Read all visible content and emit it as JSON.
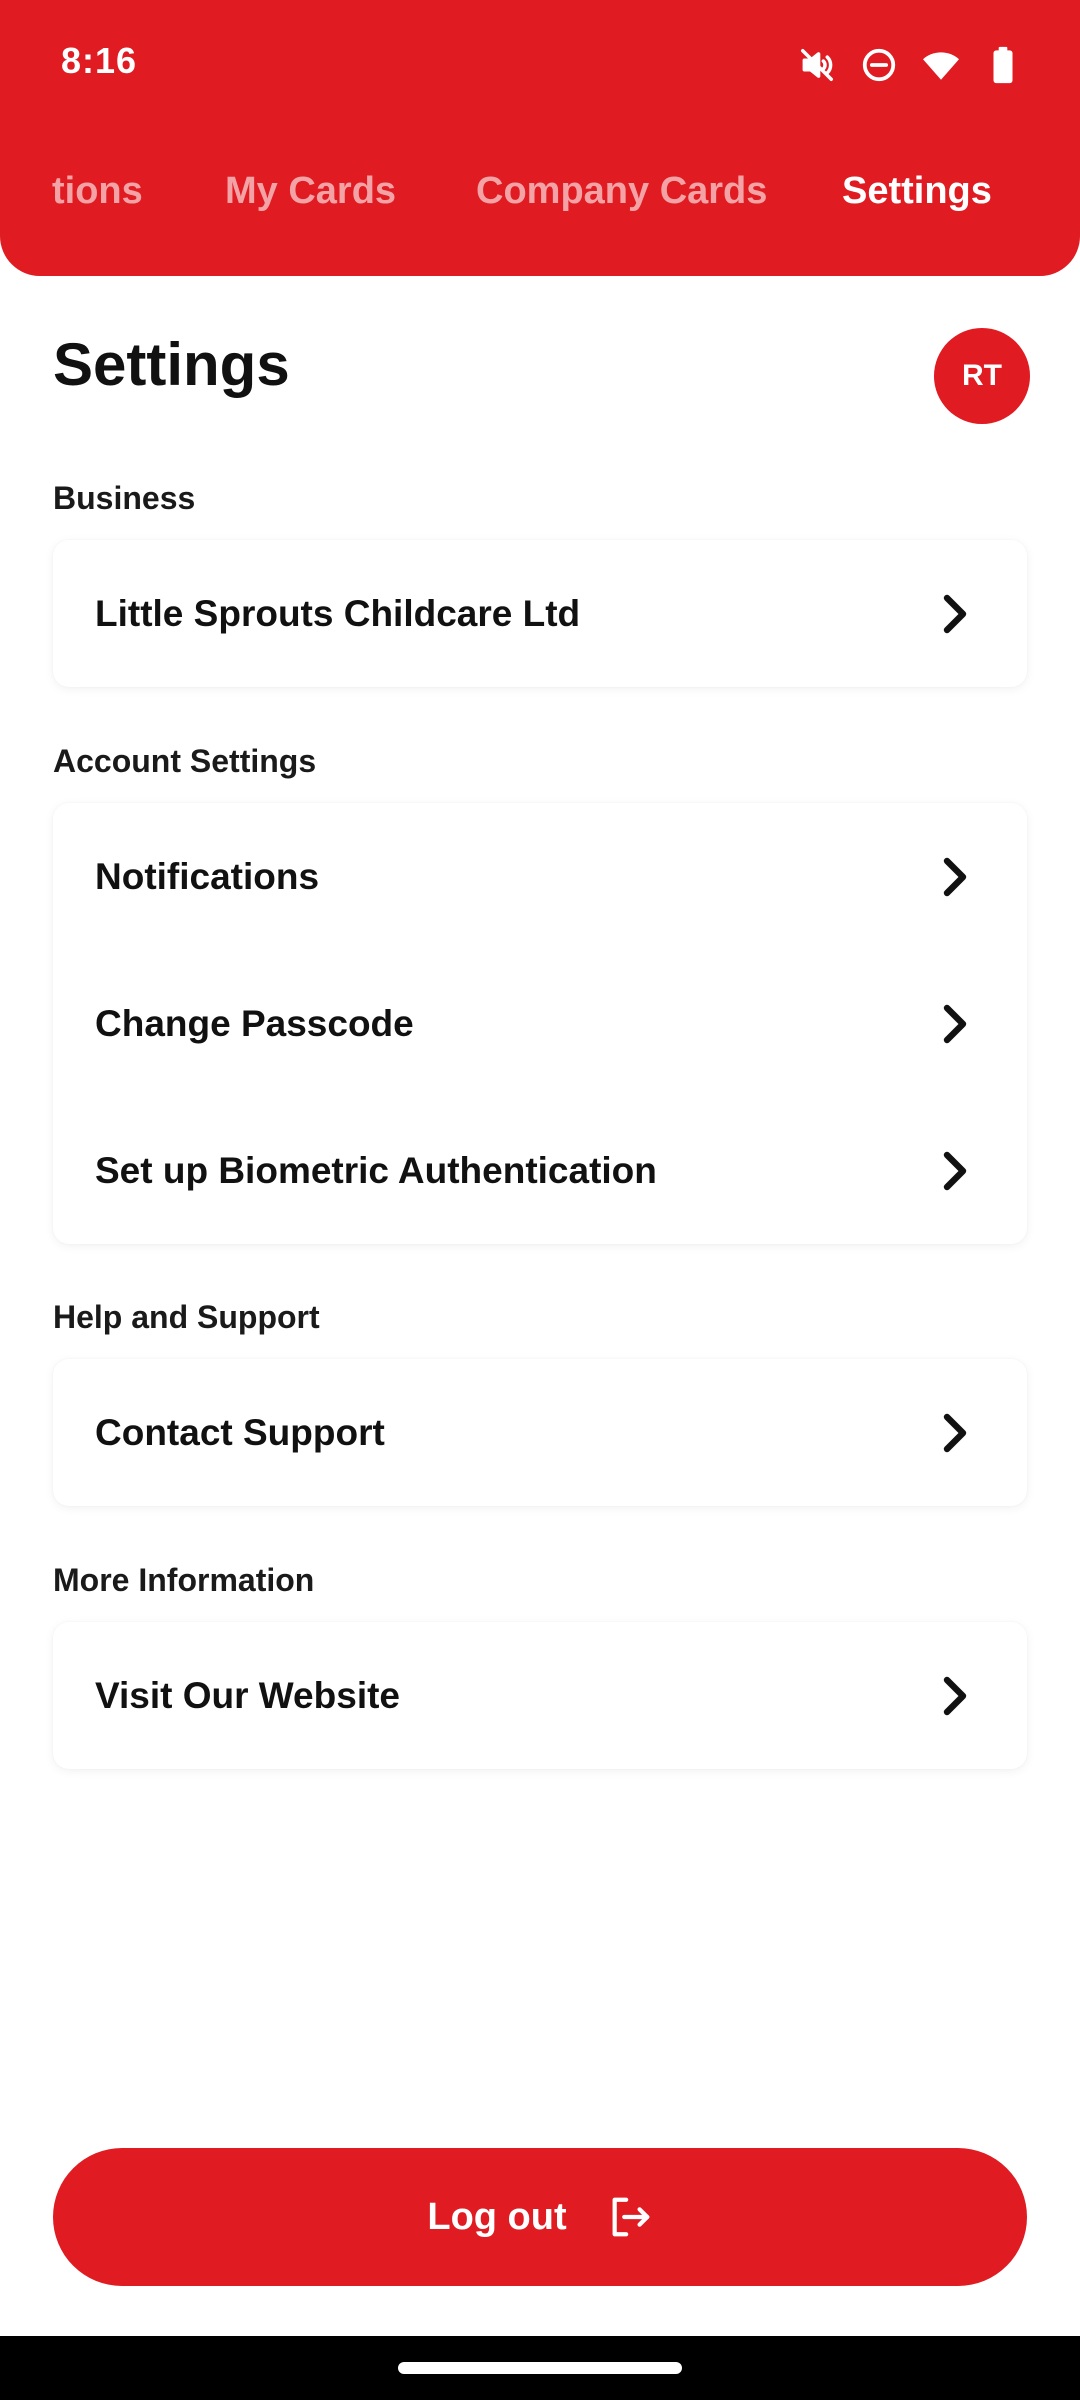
{
  "status_bar": {
    "time": "8:16",
    "icons": [
      "mute-icon",
      "do-not-disturb-icon",
      "wifi-icon",
      "battery-icon"
    ]
  },
  "tabs": [
    {
      "label": "tions",
      "active": false
    },
    {
      "label": "My Cards",
      "active": false
    },
    {
      "label": "Company Cards",
      "active": false
    },
    {
      "label": "Settings",
      "active": true
    }
  ],
  "page": {
    "title": "Settings",
    "avatar_initials": "RT"
  },
  "sections": {
    "business": {
      "label": "Business",
      "items": [
        {
          "label": "Little Sprouts Childcare Ltd"
        }
      ]
    },
    "account": {
      "label": "Account Settings",
      "items": [
        {
          "label": "Notifications"
        },
        {
          "label": "Change Passcode"
        },
        {
          "label": "Set up Biometric Authentication"
        }
      ]
    },
    "help": {
      "label": "Help and Support",
      "items": [
        {
          "label": "Contact Support"
        }
      ]
    },
    "more": {
      "label": "More Information",
      "items": [
        {
          "label": "Visit Our Website"
        }
      ]
    }
  },
  "logout": {
    "label": "Log out",
    "icon": "logout-icon"
  },
  "colors": {
    "brand_red": "#e01b22",
    "text": "#111111",
    "background": "#ffffff"
  }
}
